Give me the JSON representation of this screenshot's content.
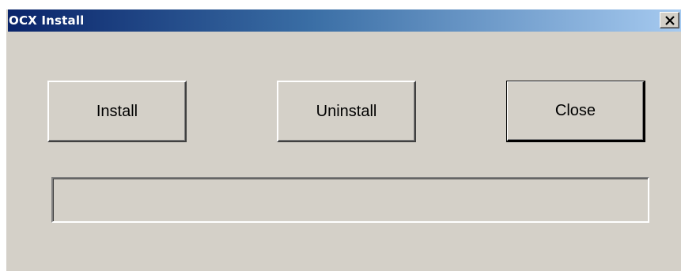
{
  "window": {
    "title": "OCX Install"
  },
  "titlebar": {
    "close_icon": "close-x-icon"
  },
  "buttons": {
    "install_label": "Install",
    "uninstall_label": "Uninstall",
    "close_label": "Close"
  },
  "progress": {
    "value": 0
  },
  "colors": {
    "dialog_face": "#d4d0c8",
    "title_start": "#0a246a",
    "title_end": "#a6caf0"
  }
}
